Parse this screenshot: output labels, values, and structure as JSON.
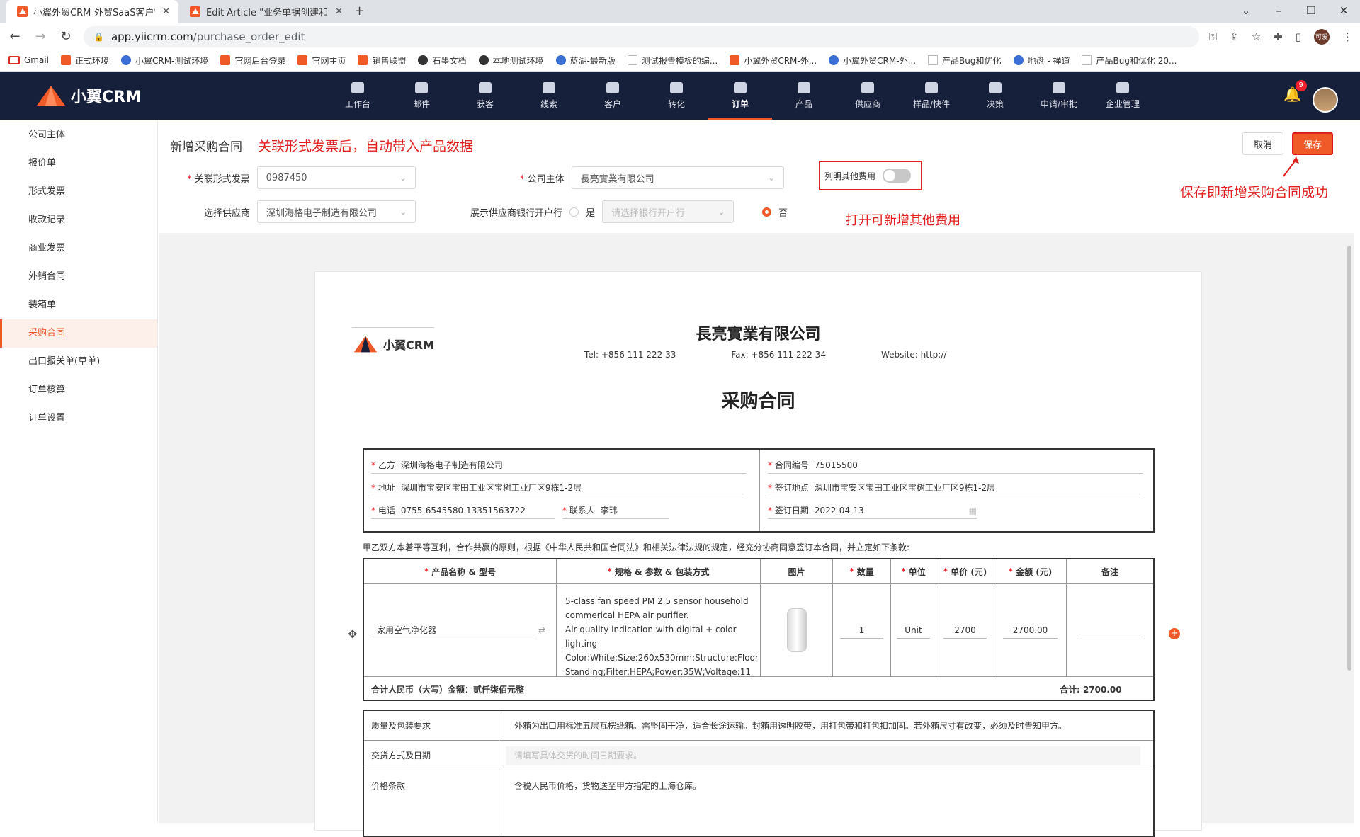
{
  "browser": {
    "tabs": [
      {
        "title": "小翼外贸CRM-外贸SaaS客户管理"
      },
      {
        "title": "Edit Article \"业务单据创建和关联"
      }
    ],
    "url_host": "app.yiicrm.com",
    "url_path": "/purchase_order_edit",
    "profile": "可爱",
    "bookmarks": [
      "Gmail",
      "正式环境",
      "小翼CRM-测试环境",
      "官网后台登录",
      "官网主页",
      "销售联盟",
      "石墨文档",
      "本地测试环境",
      "蓝湖-最新版",
      "测试报告模板的编...",
      "小翼外贸CRM-外...",
      "小翼外贸CRM-外...",
      "产品Bug和优化",
      "地盘 - 禅道",
      "产品Bug和优化 20..."
    ]
  },
  "app": {
    "logo": "小翼CRM",
    "nav": [
      "工作台",
      "邮件",
      "获客",
      "线索",
      "客户",
      "转化",
      "订单",
      "产品",
      "供应商",
      "样品/快件",
      "决策",
      "申请/审批",
      "企业管理"
    ],
    "active_nav": "订单",
    "notif_count": "9"
  },
  "sidebar": {
    "items": [
      "公司主体",
      "报价单",
      "形式发票",
      "收款记录",
      "商业发票",
      "外销合同",
      "装箱单",
      "采购合同",
      "出口报关单(草单)",
      "订单核算",
      "订单设置"
    ],
    "active": "采购合同"
  },
  "header": {
    "title": "新增采购合同",
    "annotation_main": "关联形式发票后，自动带入产品数据",
    "annotation_toggle": "打开可新增其他费用",
    "annotation_save": "保存即新增采购合同成功",
    "cancel": "取消",
    "save": "保存",
    "fields": {
      "invoice_label": "关联形式发票",
      "invoice_value": "0987450",
      "entity_label": "公司主体",
      "entity_value": "長亮實業有限公司",
      "toggle_label": "列明其他费用",
      "supplier_label": "选择供应商",
      "supplier_value": "深圳海格电子制造有限公司",
      "bank_label": "展示供应商银行开户行",
      "bank_yes": "是",
      "bank_placeholder": "请选择银行开户行",
      "bank_no": "否"
    }
  },
  "doc": {
    "company": "長亮實業有限公司",
    "tel": "Tel: +856 111 222 33",
    "fax": "Fax: +856 111 222 34",
    "website": "Website: http://",
    "title": "采购合同",
    "logo": "小翼CRM",
    "party_b_label": "乙方",
    "party_b": "深圳海格电子制造有限公司",
    "contract_no_label": "合同编号",
    "contract_no": "75015500",
    "addr_label": "地址",
    "addr": "深圳市宝安区宝田工业区宝树工业厂区9栋1-2层",
    "sign_place_label": "签订地点",
    "sign_place": "深圳市宝安区宝田工业区宝树工业厂区9栋1-2层",
    "phone_label": "电话",
    "phone": "0755-6545580 13351563722",
    "contact_label": "联系人",
    "contact": "李玮",
    "sign_date_label": "签订日期",
    "sign_date": "2022-04-13",
    "preamble": "甲乙双方本着平等互利，合作共赢的原则，根据《中华人民共和国合同法》和相关法律法规的规定，经充分协商同意签订本合同，并立定如下条款:",
    "columns": [
      "产品名称 & 型号",
      "规格 & 参数 & 包装方式",
      "图片",
      "数量",
      "单位",
      "单价 (元)",
      "金额 (元)",
      "备注"
    ],
    "row": {
      "name": "家用空气净化器",
      "spec": "5-class fan speed PM 2.5 sensor household commerical HEPA air purifier.\nAir quality indication with digital + color lighting\nColor:White;Size:260x530mm;Structure:Floor Standing;Filter:HEPA;Power:35W;Voltage:11",
      "qty": "1",
      "unit": "Unit",
      "price": "2700",
      "amount": "2700.00"
    },
    "total_words": "合计人民币（大写）金额：贰仟柒佰元整",
    "total": "合计: 2700.00",
    "terms": [
      {
        "label": "质量及包装要求",
        "value": "外箱为出口用标准五层瓦楞纸箱。需坚固干净，适合长途运输。封箱用透明胶带，用打包带和打包扣加固。若外箱尺寸有改变，必须及时告知甲方。"
      },
      {
        "label": "交货方式及日期",
        "placeholder": "请填写具体交货的时间日期要求。"
      },
      {
        "label": "价格条款",
        "value": "含税人民币价格，货物送至甲方指定的上海仓库。"
      }
    ]
  }
}
